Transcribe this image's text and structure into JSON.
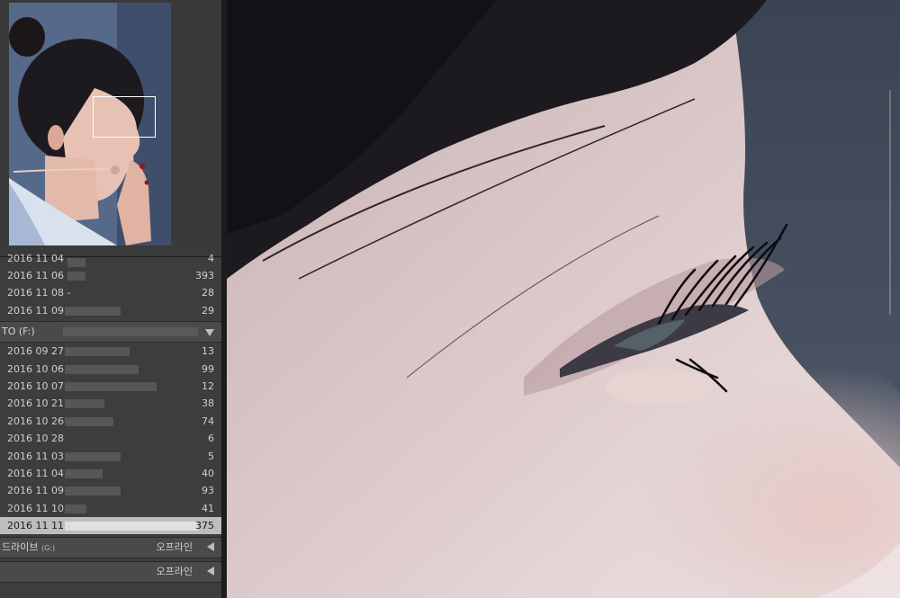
{
  "folders_top": [
    {
      "label": "2016 11 04 -",
      "count": "4"
    },
    {
      "label": "2016 11 06 -",
      "count": "393"
    },
    {
      "label": "2016 11 08 -",
      "count": "28"
    },
    {
      "label": "2016 11 09 -",
      "count": "29"
    }
  ],
  "volume_f": {
    "name": "TO (F:)"
  },
  "folders_f": [
    {
      "label": "2016 09 27 -",
      "count": "13"
    },
    {
      "label": "2016 10 06 -",
      "count": "99"
    },
    {
      "label": "2016 10 07 -",
      "count": "12"
    },
    {
      "label": "2016 10 21 -",
      "count": "38"
    },
    {
      "label": "2016 10 26 -",
      "count": "74"
    },
    {
      "label": "2016 10 28",
      "count": "6"
    },
    {
      "label": "2016 11 03 -",
      "count": "5"
    },
    {
      "label": "2016 11 04 -",
      "count": "40"
    },
    {
      "label": "2016 11 09 -",
      "count": "93"
    },
    {
      "label": "2016 11 10 -",
      "count": "41"
    },
    {
      "label": "2016 11 11 -",
      "count": "375"
    }
  ],
  "volume_g": {
    "name": "드라이브",
    "drive": "(G:)",
    "status": "오프라인"
  },
  "volume_h": {
    "status": "오프라인"
  },
  "colors": {
    "panel": "#3d3d3d",
    "selected": "#bdbdbd",
    "skin": "#e2cfcf",
    "hair": "#1d1a1f",
    "background": "#3f4a5a"
  }
}
